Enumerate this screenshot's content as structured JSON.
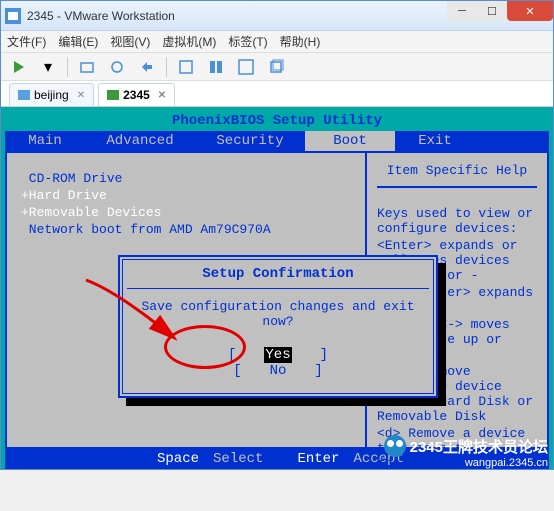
{
  "window": {
    "title": "2345 - VMware Workstation"
  },
  "menu": {
    "file": "文件(F)",
    "edit": "编辑(E)",
    "view": "视图(V)",
    "vm": "虚拟机(M)",
    "tabs": "标签(T)",
    "help": "帮助(H)"
  },
  "tabs": {
    "beijing": "beijing",
    "t2345": "2345"
  },
  "bios": {
    "title": "PhoenixBIOS Setup Utility",
    "menu": {
      "main": "Main",
      "advanced": "Advanced",
      "security": "Security",
      "boot": "Boot",
      "exit": "Exit"
    },
    "boot_items": {
      "cdrom": " CD-ROM Drive",
      "hd": "+Hard Drive",
      "rmv": "+Removable Devices",
      "net": " Network boot from AMD Am79C970A"
    },
    "help": {
      "title": "Item Specific Help",
      "body1": "Keys used to view or configure devices:",
      "body2": "<Enter> expands or collapses devices with a + or -",
      "body3": "<Ctrl+Enter> expands all",
      "body4": "<+> and <-> moves the device up or down.",
      "body5": "<n> May move removable device between Hard Disk or Removable Disk",
      "body6": "<d> Remove a device that is not installed."
    }
  },
  "dialog": {
    "title": "Setup Confirmation",
    "msg": "Save configuration changes and exit now?",
    "yes": "Yes",
    "no": "No"
  },
  "status": {
    "space_k": "Space",
    "space_v": "Select",
    "enter_k": "Enter",
    "enter_v": "Accept"
  },
  "watermark": {
    "brand": "2345王牌技术员论坛",
    "url": "wangpai.2345.cn"
  }
}
